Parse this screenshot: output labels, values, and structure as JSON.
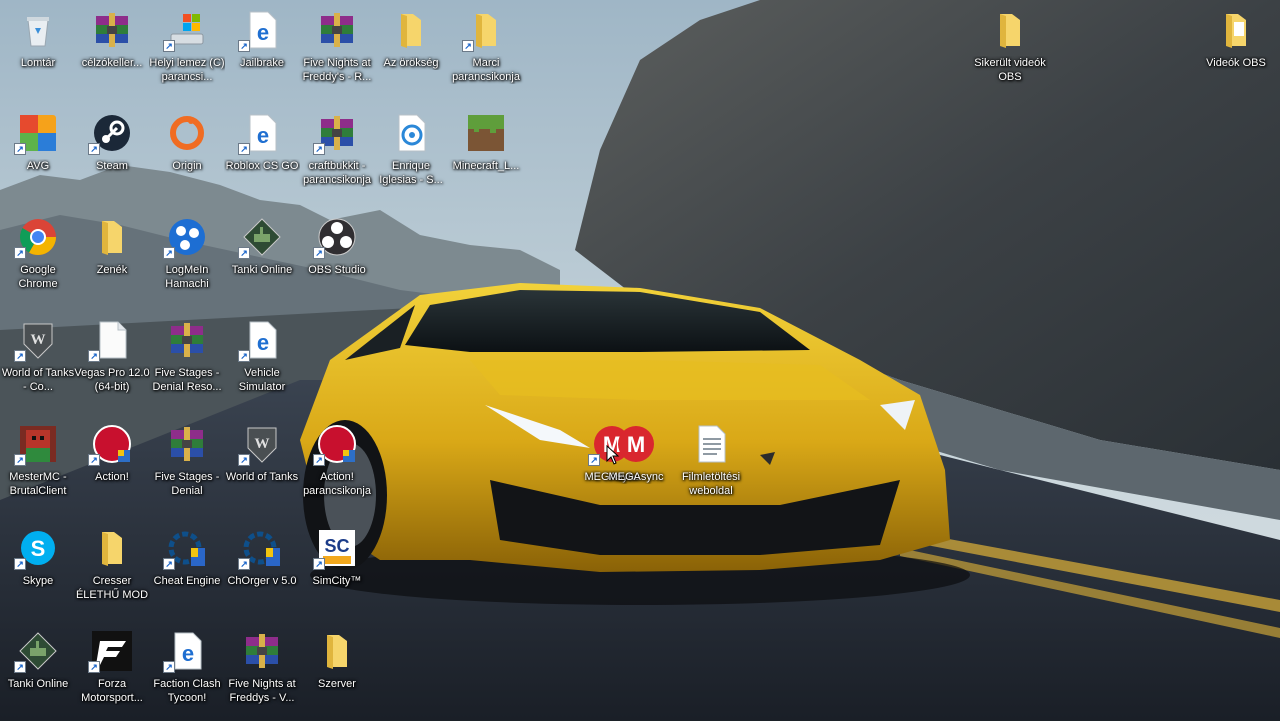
{
  "desktop": {
    "icons": [
      {
        "label": "Lomtár",
        "name": "recycle-bin-icon",
        "kind": "bin",
        "col": 0,
        "row": 0,
        "shortcut": false
      },
      {
        "label": "célzókeller...",
        "name": "archive-icon",
        "kind": "rar",
        "col": 1,
        "row": 0,
        "shortcut": false
      },
      {
        "label": "Helyi lemez (C) parancsi...",
        "name": "drive-icon",
        "kind": "drive",
        "col": 2,
        "row": 0,
        "shortcut": true
      },
      {
        "label": "Jailbrake",
        "name": "edge-icon",
        "kind": "edge",
        "col": 3,
        "row": 0,
        "shortcut": true
      },
      {
        "label": "Five Nights at Freddy's - R...",
        "name": "archive-icon",
        "kind": "rar",
        "col": 4,
        "row": 0,
        "shortcut": false
      },
      {
        "label": "Az örökség",
        "name": "folder-icon",
        "kind": "folder",
        "col": 5,
        "row": 0,
        "shortcut": false
      },
      {
        "label": "Marci parancsikonja",
        "name": "folder-icon",
        "kind": "folder",
        "col": 6,
        "row": 0,
        "shortcut": true
      },
      {
        "label": "AVG",
        "name": "avg-icon",
        "kind": "avg",
        "col": 0,
        "row": 1,
        "shortcut": true
      },
      {
        "label": "Steam",
        "name": "steam-icon",
        "kind": "steam",
        "col": 1,
        "row": 1,
        "shortcut": true
      },
      {
        "label": "Origin",
        "name": "origin-icon",
        "kind": "origin",
        "col": 2,
        "row": 1,
        "shortcut": false
      },
      {
        "label": "Roblox CS GO",
        "name": "edge-icon",
        "kind": "edge",
        "col": 3,
        "row": 1,
        "shortcut": true
      },
      {
        "label": "craftbukkit - parancsikonja",
        "name": "archive-icon",
        "kind": "rar",
        "col": 4,
        "row": 1,
        "shortcut": true
      },
      {
        "label": "Enrique Iglesias - S...",
        "name": "media-file-icon",
        "kind": "media",
        "col": 5,
        "row": 1,
        "shortcut": false
      },
      {
        "label": "Minecraft_L...",
        "name": "minecraft-icon",
        "kind": "minecraft",
        "col": 6,
        "row": 1,
        "shortcut": false
      },
      {
        "label": "Google Chrome",
        "name": "chrome-icon",
        "kind": "chrome",
        "col": 0,
        "row": 2,
        "shortcut": true
      },
      {
        "label": "Zenék",
        "name": "folder-icon",
        "kind": "folder",
        "col": 1,
        "row": 2,
        "shortcut": false
      },
      {
        "label": "LogMeIn Hamachi",
        "name": "hamachi-icon",
        "kind": "hamachi",
        "col": 2,
        "row": 2,
        "shortcut": true
      },
      {
        "label": "Tanki Online",
        "name": "tanki-icon",
        "kind": "tanki",
        "col": 3,
        "row": 2,
        "shortcut": true
      },
      {
        "label": "OBS Studio",
        "name": "obs-icon",
        "kind": "obs",
        "col": 4,
        "row": 2,
        "shortcut": true
      },
      {
        "label": "World of Tanks - Co...",
        "name": "wot-icon",
        "kind": "wot",
        "col": 0,
        "row": 3,
        "shortcut": true
      },
      {
        "label": "Vegas Pro 12.0 (64-bit)",
        "name": "file-icon",
        "kind": "file",
        "col": 1,
        "row": 3,
        "shortcut": true
      },
      {
        "label": "Five Stages - Denial Reso...",
        "name": "archive-icon",
        "kind": "rar",
        "col": 2,
        "row": 3,
        "shortcut": false
      },
      {
        "label": "Vehicle Simulator",
        "name": "edge-icon",
        "kind": "edge",
        "col": 3,
        "row": 3,
        "shortcut": true
      },
      {
        "label": "MesterMC - BrutalClient",
        "name": "mestermc-icon",
        "kind": "mestermc",
        "col": 0,
        "row": 4,
        "shortcut": true
      },
      {
        "label": "Action!",
        "name": "action-icon",
        "kind": "action",
        "col": 1,
        "row": 4,
        "shortcut": true
      },
      {
        "label": "Five Stages - Denial",
        "name": "archive-icon",
        "kind": "rar",
        "col": 2,
        "row": 4,
        "shortcut": false
      },
      {
        "label": "World of Tanks",
        "name": "wot-icon",
        "kind": "wot",
        "col": 3,
        "row": 4,
        "shortcut": true
      },
      {
        "label": "Action! parancsikonja",
        "name": "action-icon",
        "kind": "action",
        "col": 4,
        "row": 4,
        "shortcut": true
      },
      {
        "label": "Skype",
        "name": "skype-icon",
        "kind": "skype",
        "col": 0,
        "row": 5,
        "shortcut": true
      },
      {
        "label": "Cresser ÉLETHŰ MOD",
        "name": "folder-icon",
        "kind": "folder",
        "col": 1,
        "row": 5,
        "shortcut": false
      },
      {
        "label": "Cheat Engine",
        "name": "cheat-engine-icon",
        "kind": "cheat",
        "col": 2,
        "row": 5,
        "shortcut": true
      },
      {
        "label": "ChOrger v 5.0",
        "name": "cheat-engine-icon",
        "kind": "cheat",
        "col": 3,
        "row": 5,
        "shortcut": true
      },
      {
        "label": "SimCity™",
        "name": "simcity-icon",
        "kind": "simcity",
        "col": 4,
        "row": 5,
        "shortcut": true
      },
      {
        "label": "Tanki Online",
        "name": "tanki-icon",
        "kind": "tanki",
        "col": 0,
        "row": 6,
        "shortcut": true
      },
      {
        "label": "Forza Motorsport...",
        "name": "forza-icon",
        "kind": "forza",
        "col": 1,
        "row": 6,
        "shortcut": true
      },
      {
        "label": "Faction Clash Tycoon!",
        "name": "edge-icon",
        "kind": "edge",
        "col": 2,
        "row": 6,
        "shortcut": true
      },
      {
        "label": "Five Nights at Freddys - V...",
        "name": "archive-icon",
        "kind": "rar",
        "col": 3,
        "row": 6,
        "shortcut": false
      },
      {
        "label": "Szerver",
        "name": "folder-icon",
        "kind": "folder",
        "col": 4,
        "row": 6,
        "shortcut": false
      }
    ],
    "free_icons": [
      {
        "label": "MEGAsync",
        "name": "megasync-icon",
        "kind": "mega",
        "slot": "mega-a",
        "shortcut": true
      },
      {
        "label": "MEGAsync",
        "name": "megasync-icon",
        "kind": "mega",
        "slot": "mega-b",
        "shortcut": false
      },
      {
        "label": "Filmletöltési weboldal",
        "name": "text-file-icon",
        "kind": "txt",
        "slot": "film",
        "shortcut": false
      },
      {
        "label": "Sikerült videók OBS",
        "name": "folder-icon",
        "kind": "folder",
        "slot": "sikerult",
        "shortcut": false
      },
      {
        "label": "Videók OBS",
        "name": "folder-icon",
        "kind": "folder-doc",
        "slot": "videok",
        "shortcut": false
      }
    ]
  }
}
